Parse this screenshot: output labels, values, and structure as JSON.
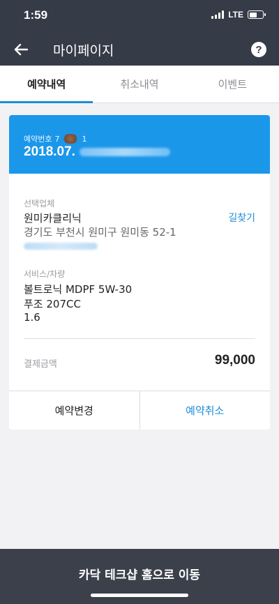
{
  "status_bar": {
    "time": "1:59",
    "network": "LTE"
  },
  "header": {
    "title": "마이페이지",
    "help_label": "?"
  },
  "tabs": [
    {
      "label": "예약내역",
      "active": true
    },
    {
      "label": "취소내역",
      "active": false
    },
    {
      "label": "이벤트",
      "active": false
    }
  ],
  "reservation": {
    "number_label": "예약번호",
    "number_visible": "7",
    "number_visible_end": "1",
    "date_prefix": "2018.07.",
    "shop_section_label": "선택업체",
    "shop_name": "원미카클리닉",
    "route_link": "길찾기",
    "shop_address": "경기도 부천시 원미구 원미동 52-1",
    "service_section_label": "서비스/차량",
    "service_name": "볼트로닉 MDPF 5W-30",
    "vehicle_model": "푸조 207CC",
    "engine": "1.6",
    "payment_label": "결제금액",
    "payment_amount": "99,000",
    "change_button": "예약변경",
    "cancel_button": "예약취소"
  },
  "footer": {
    "home_button": "카닥 테크샵 홈으로 이동"
  },
  "colors": {
    "header_bg": "#363b48",
    "accent": "#1b97ea",
    "link": "#1a8fd8",
    "footer_bg": "#3c404b"
  }
}
